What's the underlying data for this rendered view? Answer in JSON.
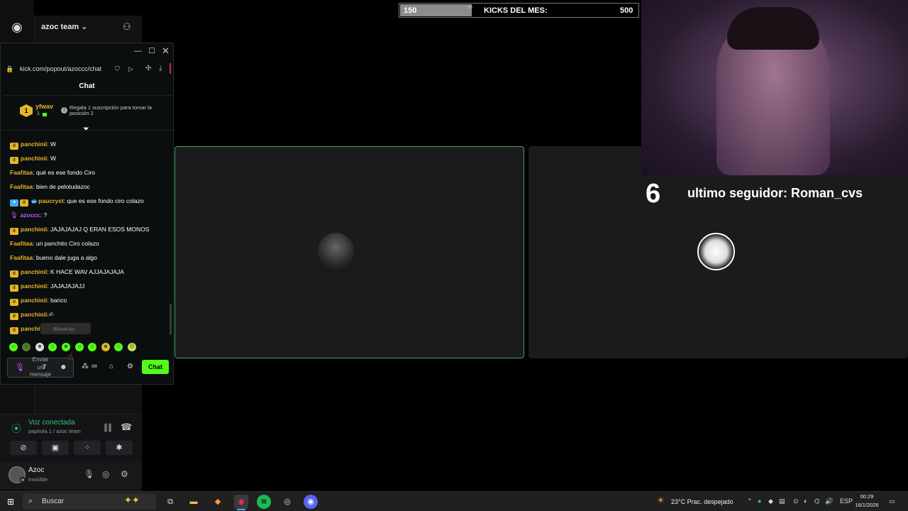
{
  "discord": {
    "server_name": "azoc team",
    "voice": {
      "title": "Voz conectada",
      "subtitle": "papirola 1 / azoc team"
    },
    "user": {
      "name": "Azoc",
      "status": "Invisible"
    }
  },
  "overlay": {
    "kicks": {
      "current": "150",
      "m_label": "m",
      "title": "KICKS DEL MES:",
      "goal": "500",
      "progress": 0.3
    },
    "follower": {
      "count": "6",
      "text": "ultimo seguidor: Roman_cvs"
    }
  },
  "browser": {
    "url": "kick.com/popout/azoccc/chat",
    "chat_title": "Chat",
    "pinned": {
      "rank": "1",
      "user": "yfwav",
      "count": "1",
      "text": "Regala 1 suscripción para tomar la posición 2"
    },
    "messages": [
      {
        "user": "panchinii",
        "text": ": W",
        "badge": "crown",
        "color": "#e4b627"
      },
      {
        "user": "panchinii",
        "text": ": W",
        "badge": "crown",
        "color": "#e4b627"
      },
      {
        "user": "Faafitaa",
        "text": ": qué es ese fondo Ciro",
        "badge": "",
        "color": "#e4b627"
      },
      {
        "user": "Faafitaa",
        "text": ": bien de pelotudazoc",
        "badge": "",
        "color": "#e4b627"
      },
      {
        "user": "paucryst",
        "text": ": que es ese fondo ciro colazo",
        "badge": "multi",
        "color": "#e4b627"
      },
      {
        "user": "azoccc",
        "text": ": ?",
        "badge": "mic",
        "color": "#c05bff"
      },
      {
        "user": "panchinii",
        "text": ": JAJAJAJAJ Q ERAN ESOS MONOS",
        "badge": "crown",
        "color": "#e4b627"
      },
      {
        "user": "Faafitaa",
        "text": ": un panchito Ciro colazo",
        "badge": "",
        "color": "#e4b627"
      },
      {
        "user": "Faafitaa",
        "text": ": bueno dale juga a algo",
        "badge": "",
        "color": "#e4b627"
      },
      {
        "user": "panchinii",
        "text": ": K HACE WAV AJJAJAJAJA",
        "badge": "crown",
        "color": "#e4b627"
      },
      {
        "user": "panchinii",
        "text": ": JAJAJAJAJJ",
        "badge": "crown",
        "color": "#e4b627"
      },
      {
        "user": "panchinii",
        "text": ": banco",
        "badge": "crown",
        "color": "#e4b627"
      },
      {
        "user": "panchinii",
        "text": ":",
        "badge": "crown",
        "color": "#e4b627"
      },
      {
        "user": "panchinii",
        "text": ":",
        "badge": "crown",
        "color": "#e4b627"
      }
    ],
    "tooltip": "BlowKiss",
    "input_placeholder": "Enviar un mensaje",
    "send_label": "Chat"
  },
  "taskbar": {
    "search_placeholder": "Buscar",
    "weather": "23°C  Prac. despejado",
    "lang": "ESP",
    "time": "00:29",
    "date": "16/1/2026"
  },
  "colors": {
    "kick_green": "#53fc18",
    "discord_voice_green": "#35c26b",
    "sub_gold": "#e4b627"
  }
}
